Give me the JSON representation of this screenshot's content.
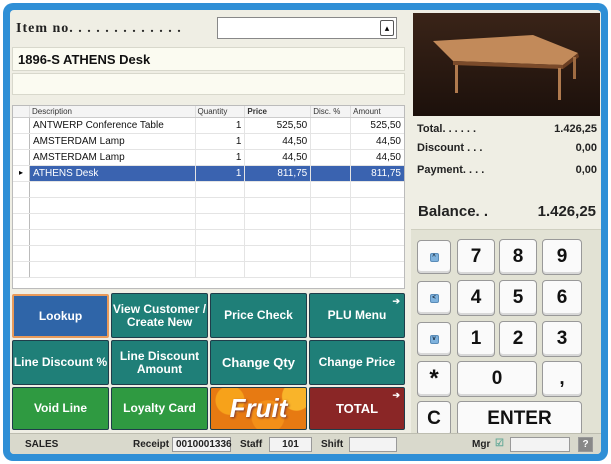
{
  "item": {
    "label": "Item no. . . . . . . . . . . . .",
    "dropdown_icon": "dropdown-arrow-icon",
    "name": "1896-S ATHENS Desk"
  },
  "grid": {
    "headers": [
      "Description",
      "Quantity",
      "Price",
      "Disc. %",
      "Amount"
    ],
    "rows": [
      {
        "description": "ANTWERP Conference Table",
        "quantity": "1",
        "price": "525,50",
        "disc": "",
        "amount": "525,50"
      },
      {
        "description": "AMSTERDAM Lamp",
        "quantity": "1",
        "price": "44,50",
        "disc": "",
        "amount": "44,50"
      },
      {
        "description": "AMSTERDAM Lamp",
        "quantity": "1",
        "price": "44,50",
        "disc": "",
        "amount": "44,50"
      },
      {
        "description": "ATHENS Desk",
        "quantity": "1",
        "price": "811,75",
        "disc": "",
        "amount": "811,75"
      }
    ],
    "selected_marker": "▸"
  },
  "totals": {
    "total_label": "Total. . . . . .",
    "total_value": "1.426,25",
    "discount_label": "Discount . . .",
    "discount_value": "0,00",
    "payment_label": "Payment. . . .",
    "payment_value": "0,00",
    "balance_label": "Balance. .",
    "balance_value": "1.426,25"
  },
  "keypad": {
    "up_icon": "^",
    "left_icon": "<",
    "down_icon": "v",
    "keys": [
      "7",
      "8",
      "9",
      "4",
      "5",
      "6",
      "1",
      "2",
      "3"
    ],
    "star": "*",
    "zero": "0",
    "comma": ",",
    "clear": "C",
    "enter": "ENTER"
  },
  "buttons": {
    "lookup": "Lookup",
    "view_customer": "View Customer / Create New",
    "price_check": "Price Check",
    "plu_menu": "PLU Menu",
    "line_discount_pct": "Line Discount %",
    "line_discount_amount": "Line Discount Amount",
    "change_qty": "Change Qty",
    "change_price": "Change Price",
    "void_line": "Void Line",
    "loyalty_card": "Loyalty Card",
    "fruit": "Fruit",
    "total": "TOTAL",
    "submenu_arrow": "➔"
  },
  "status": {
    "mode": "SALES",
    "receipt_label": "Receipt",
    "receipt_value": "0010001336",
    "staff_label": "Staff",
    "staff_value": "101",
    "shift_label": "Shift",
    "shift_value": "",
    "mgr_label": "Mgr",
    "mgr_check": "☑",
    "help": "?"
  },
  "colors": {
    "frame": "#2f8fd6",
    "selected_row": "#3a63b0",
    "lookup": "#2f65a8",
    "teal": "#1f7f78",
    "green": "#2f9a41",
    "total": "#8a2626"
  }
}
